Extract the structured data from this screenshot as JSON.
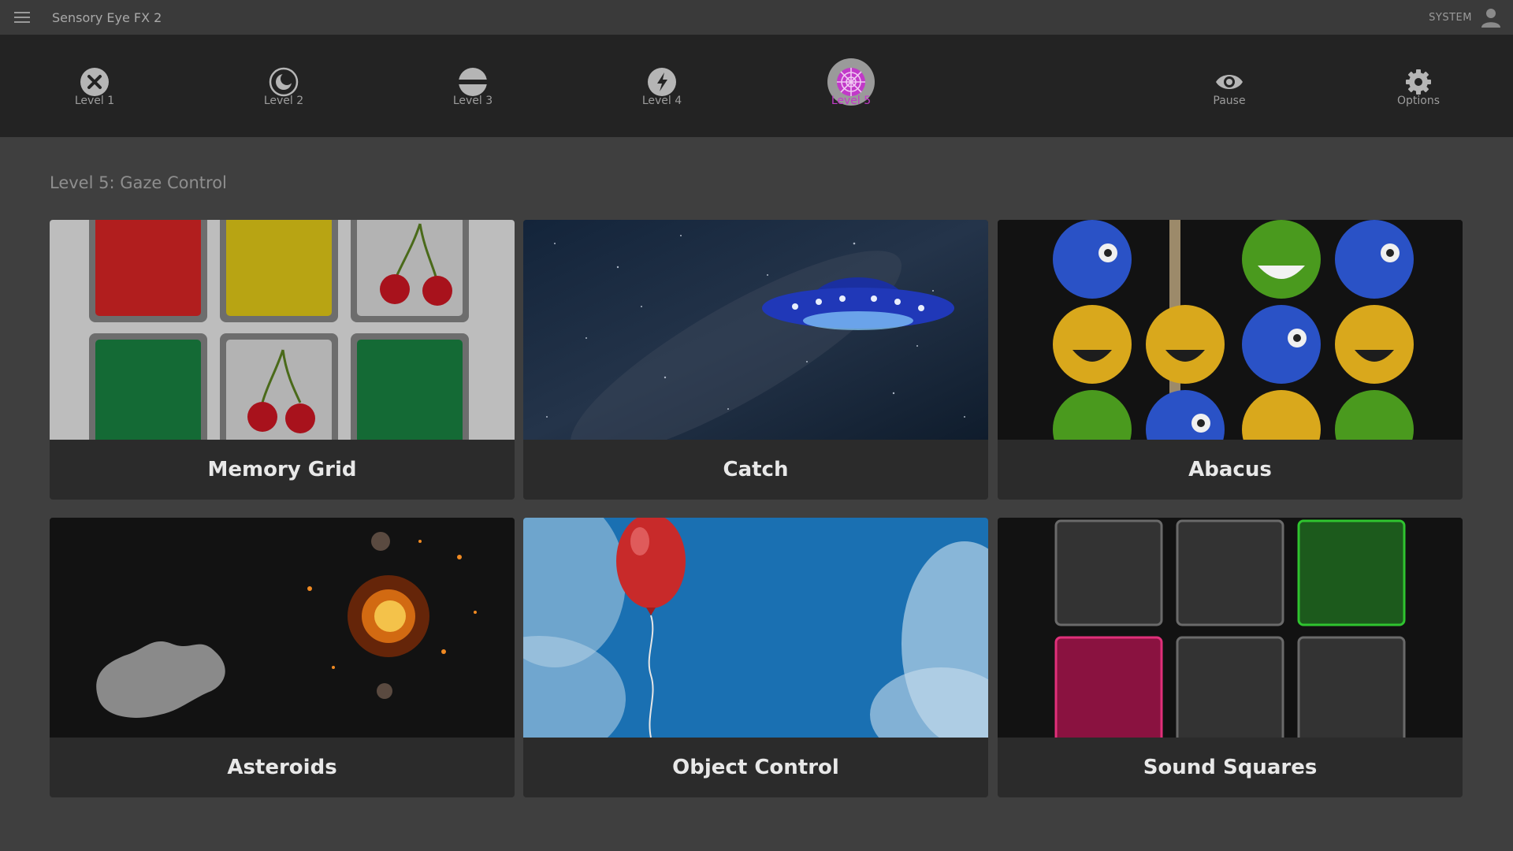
{
  "app": {
    "title": "Sensory Eye FX 2",
    "user": "SYSTEM"
  },
  "toolbar": {
    "levels": [
      {
        "label": "Level 1",
        "icon": "close-circle-icon"
      },
      {
        "label": "Level 2",
        "icon": "moon-circle-icon"
      },
      {
        "label": "Level 3",
        "icon": "split-circle-icon"
      },
      {
        "label": "Level 4",
        "icon": "lightning-circle-icon"
      },
      {
        "label": "Level 5",
        "icon": "web-globe-icon",
        "active": true
      }
    ],
    "pause_label": "Pause",
    "options_label": "Options"
  },
  "content": {
    "section_title": "Level 5: Gaze Control",
    "games": [
      {
        "label": "Memory Grid"
      },
      {
        "label": "Catch"
      },
      {
        "label": "Abacus"
      },
      {
        "label": "Asteroids"
      },
      {
        "label": "Object Control"
      },
      {
        "label": "Sound Squares"
      }
    ]
  },
  "colors": {
    "accent": "#c239c9",
    "toolbar_bg": "#232323",
    "page_bg": "#3f3f3f"
  }
}
